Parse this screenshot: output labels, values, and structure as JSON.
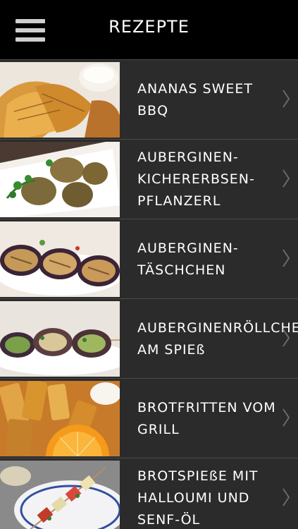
{
  "header": {
    "title": "REZEPTE",
    "menu_icon": "hamburger-menu-icon"
  },
  "recipes": [
    {
      "label": "ANANAS SWEET BBQ",
      "icon": "chevron-right-icon"
    },
    {
      "label": "AUBERGINEN-\nKICHERERBSEN-\nPFLANZERL",
      "icon": "chevron-right-icon"
    },
    {
      "label": "AUBERGINEN-\nTÄSCHCHEN",
      "icon": "chevron-right-icon"
    },
    {
      "label": "AUBERGINENRÖLLCHEN\nAM SPIEß",
      "icon": "chevron-right-icon"
    },
    {
      "label": "BROTFRITTEN VOM\nGRILL",
      "icon": "chevron-right-icon"
    },
    {
      "label": "BROTSPIEßE MIT\nHALLOUMI UND\nSENF-ÖL",
      "icon": "chevron-right-icon"
    }
  ],
  "colors": {
    "header_bg": "#000000",
    "list_bg": "#2b2b2b",
    "divider": "#4a4a4a",
    "text": "#ffffff",
    "chevron": "#6a6a6a"
  }
}
